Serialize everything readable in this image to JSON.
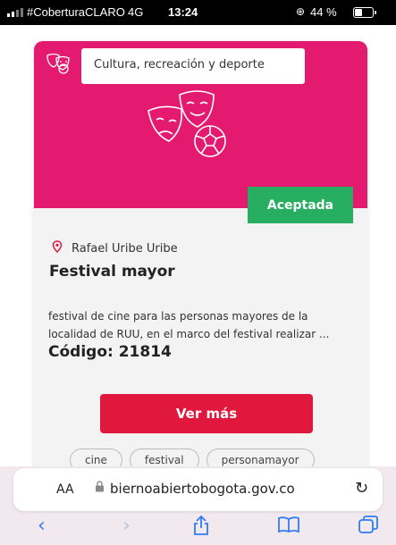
{
  "status_bar": {
    "carrier": "#CoberturaCLARO",
    "network": "4G",
    "time": "13:24",
    "battery_percent": "44 %",
    "battery_level": 0.44,
    "rotation_lock_icon": "rotation-lock-icon"
  },
  "card": {
    "header_color": "#e31a6f",
    "category": "Cultura, recreación y deporte",
    "category_icon": "theater-masks-icon",
    "illustration": "theater-masks-soccer-ball-icon",
    "status": "Aceptada",
    "status_color": "#27ae60",
    "location": "Rafael Uribe Uribe",
    "title": "Festival mayor",
    "description_line1": "festival de cine para las personas mayores de la",
    "description_line2": "localidad de RUU, en el marco del festival realizar ...",
    "code": "Código: 21814",
    "more_button": "Ver más",
    "more_button_color": "#e0183d",
    "tags": [
      "cine",
      "festival",
      "personamayor"
    ]
  },
  "browser": {
    "text_size_label": "AA",
    "url": "biernoabiertobogota.gov.co",
    "reload_icon": "reload-icon",
    "toolbar": {
      "back_icon": "back-chevron-icon",
      "forward_icon": "forward-chevron-icon",
      "share_icon": "share-icon",
      "bookmarks_icon": "bookmarks-book-icon",
      "tabs_icon": "tabs-icon"
    }
  }
}
